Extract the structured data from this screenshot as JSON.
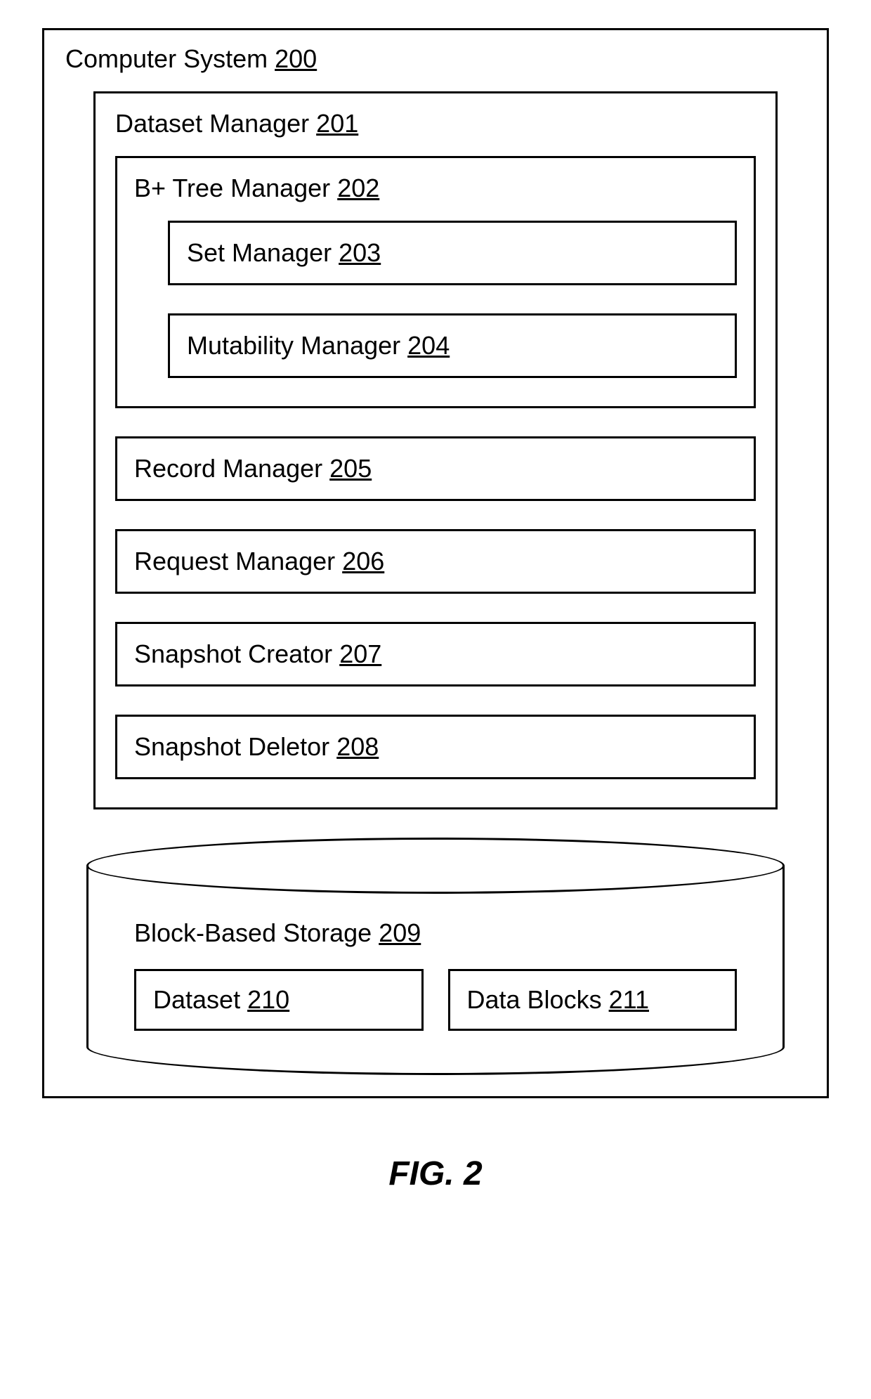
{
  "computerSystem": {
    "label": "Computer System",
    "num": "200"
  },
  "datasetManager": {
    "label": "Dataset Manager",
    "num": "201"
  },
  "btreeManager": {
    "label": "B+ Tree Manager",
    "num": "202"
  },
  "setManager": {
    "label": "Set Manager",
    "num": "203"
  },
  "mutabilityManager": {
    "label": "Mutability Manager",
    "num": "204"
  },
  "recordManager": {
    "label": "Record Manager",
    "num": "205"
  },
  "requestManager": {
    "label": "Request Manager",
    "num": "206"
  },
  "snapshotCreator": {
    "label": "Snapshot Creator",
    "num": "207"
  },
  "snapshotDeletor": {
    "label": "Snapshot Deletor",
    "num": "208"
  },
  "blockStorage": {
    "label": "Block-Based Storage",
    "num": "209"
  },
  "dataset": {
    "label": "Dataset",
    "num": "210"
  },
  "dataBlocks": {
    "label": "Data Blocks",
    "num": "211"
  },
  "caption": "FIG. 2"
}
